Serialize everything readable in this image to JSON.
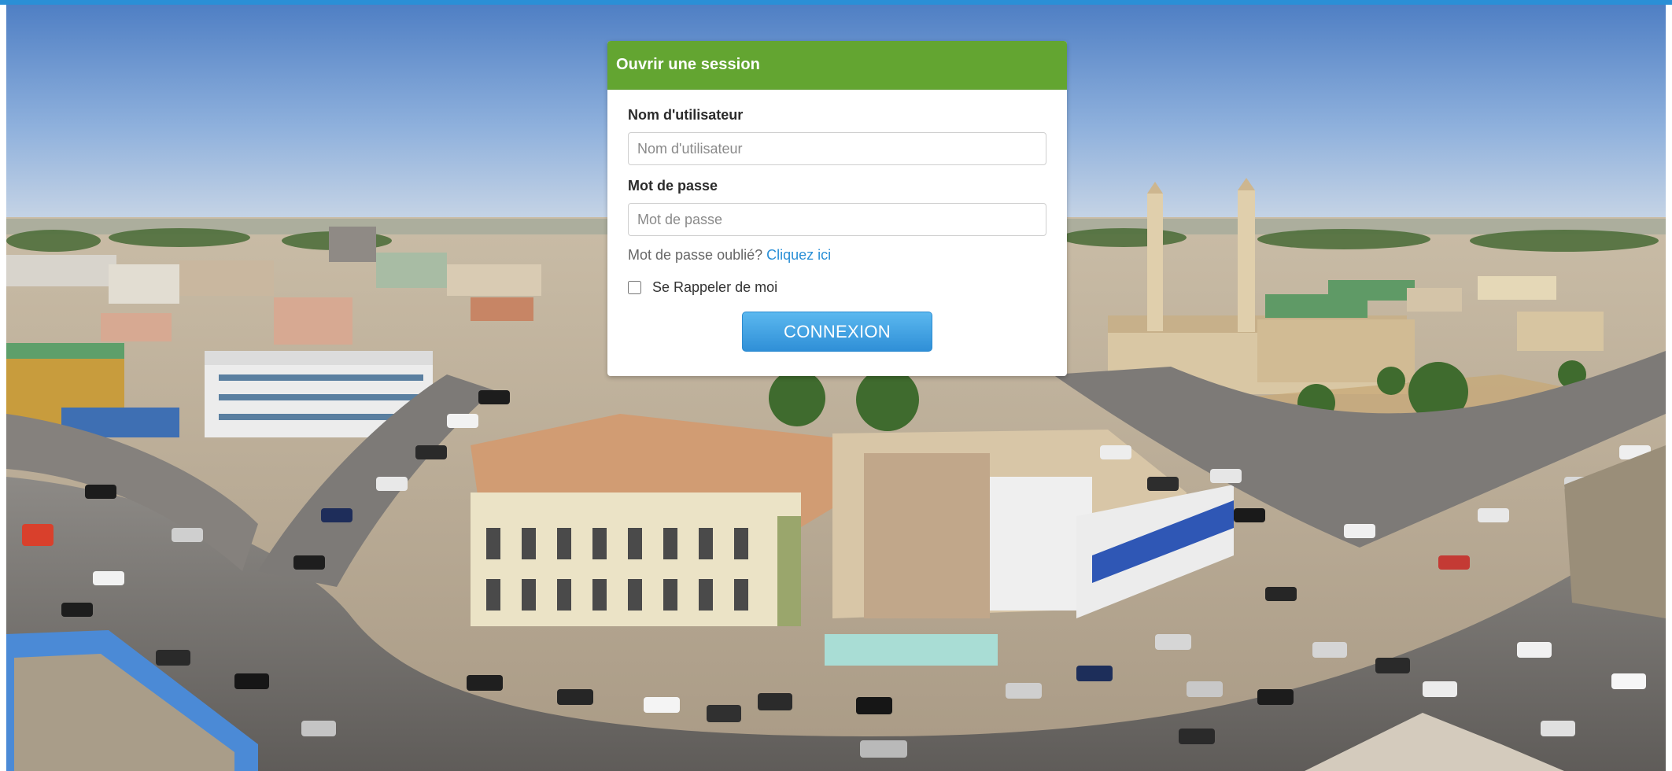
{
  "login": {
    "title": "Ouvrir une session",
    "username_label": "Nom d'utilisateur",
    "username_placeholder": "Nom d'utilisateur",
    "username_value": "",
    "password_label": "Mot de passe",
    "password_placeholder": "Mot de passe",
    "password_value": "",
    "forgot_text": "Mot de passe oublié?",
    "forgot_link": "Cliquez ici",
    "remember_label": "Se Rappeler de moi",
    "remember_checked": false,
    "submit_label": "CONNEXION"
  },
  "colors": {
    "header_green": "#63a531",
    "button_blue": "#2f8fd7",
    "link_blue": "#2a8fd6",
    "top_strip": "#2a8fd6"
  },
  "background": {
    "description_icon": "city-panorama-image"
  }
}
